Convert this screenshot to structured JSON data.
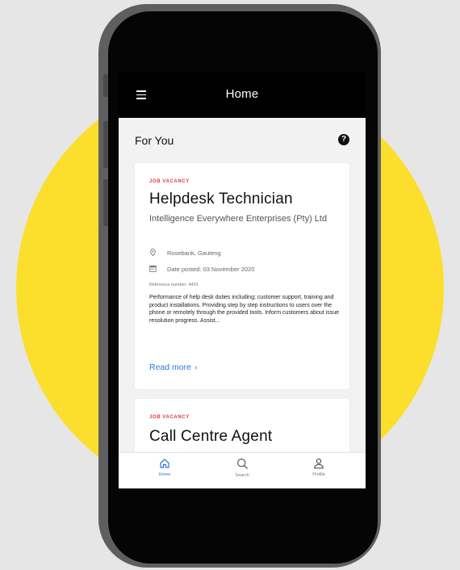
{
  "app": {
    "title": "Home"
  },
  "section": {
    "title": "For You",
    "help_icon": "help-icon",
    "help_symbol": "?"
  },
  "jobs": [
    {
      "tag": "JOB VACANCY",
      "title": "Helpdesk Technician",
      "company": "Intelligence Everywhere Enterprises (Pty) Ltd",
      "location": "Rosebank, Gauteng",
      "date_posted": "Date posted: 03 November 2020",
      "reference": "Reference number: 4491",
      "description": "Performance of help desk duties including; customer support, training and product installations. Providing step by step instructions to users over the phone or remotely through the provided tools. Inform customers about issue resolution progress. Assist...",
      "read_more": "Read more",
      "read_more_chevron": "›"
    },
    {
      "tag": "JOB VACANCY",
      "title": "Call Centre Agent"
    }
  ],
  "bottom_nav": {
    "items": [
      {
        "label": "Home",
        "icon": "home-icon",
        "active": true
      },
      {
        "label": "Search",
        "icon": "search-icon",
        "active": false
      },
      {
        "label": "Profile",
        "icon": "profile-icon",
        "active": false
      }
    ]
  },
  "colors": {
    "background": "#e6e6e6",
    "accent_circle": "#fbdf2c",
    "app_bar": "#000000",
    "tag": "#e03a3a",
    "link": "#2a7ad8"
  }
}
